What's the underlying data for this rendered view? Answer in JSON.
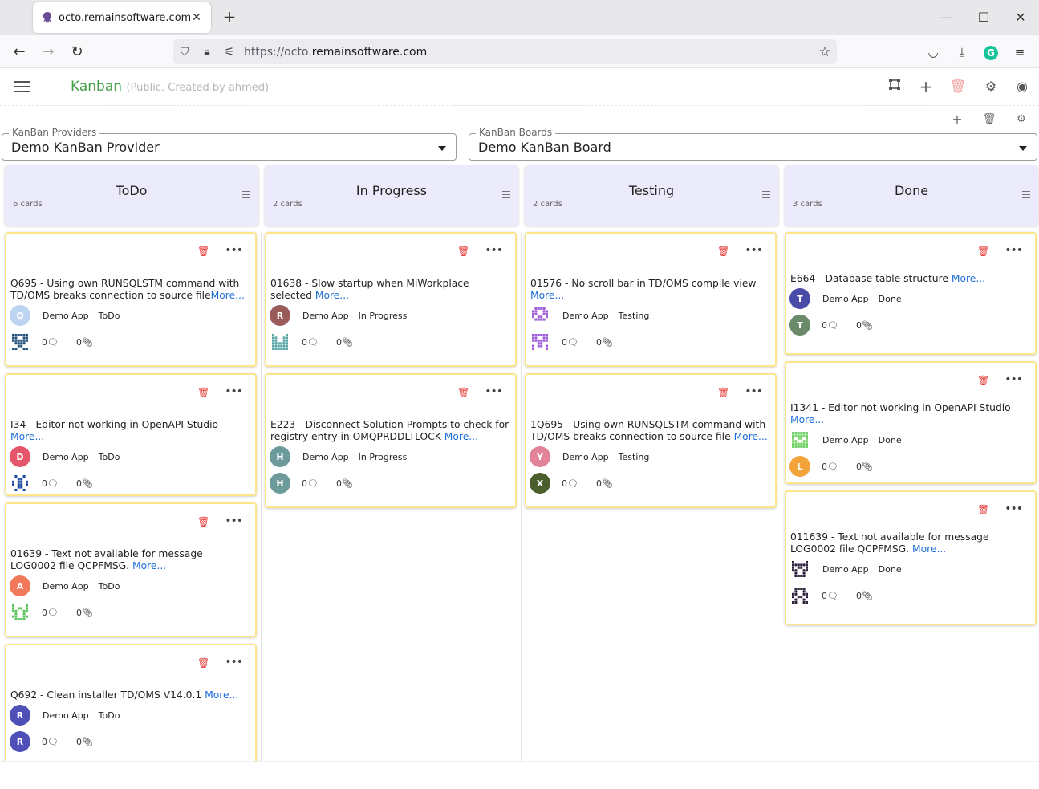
{
  "browser": {
    "tab_title": "octo.remainsoftware.com/",
    "url_scheme": "https://octo.",
    "url_host": "remainsoftware.com",
    "new_tab": "+",
    "close_tab": "✕"
  },
  "app": {
    "title": "Kanban",
    "subtitle": "(Public. Created by ahmed)"
  },
  "selects": {
    "providers_label": "KanBan Providers",
    "providers_value": "Demo KanBan Provider",
    "boards_label": "KanBan Boards",
    "boards_value": "Demo KanBan Board"
  },
  "columns": [
    {
      "name": "ToDo",
      "count": "6 cards",
      "cards": [
        {
          "id_title": " Q695 - Using own RUNSQLSTM command with TD/OMS breaks connection to source file",
          "more": "More...",
          "avatar": "Q",
          "avatar_color": "#bcd3f2",
          "app": "Demo App",
          "status": "ToDo",
          "comments": "0",
          "attachments": "0"
        },
        {
          "id_title": "I34 - Editor not working in OpenAPI Studio ",
          "more": "More...",
          "avatar": "D",
          "avatar_color": "#e5566a",
          "app": "Demo App",
          "status": "ToDo",
          "comments": "0",
          "attachments": "0"
        },
        {
          "id_title": "01639 - Text not available for message LOG0002 file QCPFMSG. ",
          "more": "More...",
          "avatar": "A",
          "avatar_color": "#f07a5b",
          "app": "Demo App",
          "status": "ToDo",
          "comments": "0",
          "attachments": "0"
        },
        {
          "id_title": "Q692 - Clean installer TD/OMS V14.0.1 ",
          "more": "More...",
          "avatar": "R",
          "avatar_color": "#4f4fb8",
          "app": "Demo App",
          "status": "ToDo",
          "comments": "0",
          "attachments": "0"
        }
      ]
    },
    {
      "name": "In Progress",
      "count": "2 cards",
      "cards": [
        {
          "id_title": "01638 - Slow startup when MiWorkplace selected ",
          "more": "More...",
          "avatar": "R",
          "avatar_color": "#9c5b5b",
          "app": "Demo App",
          "status": "In Progress",
          "comments": "0",
          "attachments": "0"
        },
        {
          "id_title": "E223 - Disconnect Solution Prompts to check for registry entry in OMQPRDDLTLOCK ",
          "more": "More...",
          "avatar": "H",
          "avatar_color": "#6d9a9a",
          "app": "Demo App",
          "status": "In Progress",
          "comments": "0",
          "attachments": "0"
        }
      ]
    },
    {
      "name": "Testing",
      "count": "2 cards",
      "cards": [
        {
          "id_title": "01576 - No scroll bar in TD/OMS compile view ",
          "more": "More...",
          "avatar": "",
          "avatar_color": "#ffffff",
          "app": "Demo App",
          "status": "Testing",
          "comments": "0",
          "attachments": "0"
        },
        {
          "id_title": " 1Q695 - Using own RUNSQLSTM command with TD/OMS breaks connection to source file ",
          "more": "More...",
          "avatar": "Y",
          "avatar_color": "#e2839a",
          "app": "Demo App",
          "status": "Testing",
          "comments": "0",
          "attachments": "0"
        }
      ]
    },
    {
      "name": "Done",
      "count": "3 cards",
      "cards": [
        {
          "id_title": "E664 - Database table structure ",
          "more": "More...",
          "avatar": "T",
          "avatar_color": "#4a4aa8",
          "app": "Demo App",
          "status": "Done",
          "comments": "0",
          "attachments": "0"
        },
        {
          "id_title": "I1341 - Editor not working in OpenAPI Studio ",
          "more": "More...",
          "avatar": "",
          "avatar_color": "#ffffff",
          "app": "Demo App",
          "status": "Done",
          "comments": "0",
          "attachments": "0"
        },
        {
          "id_title": "011639 - Text not available for message LOG0002 file QCPFMSG. ",
          "more": "More...",
          "avatar": "",
          "avatar_color": "#ffffff",
          "app": "Demo App",
          "status": "Done",
          "comments": "0",
          "attachments": "0"
        }
      ]
    }
  ],
  "second_avatars": {
    "todo_1": {
      "letter": "",
      "color": "#ffffff"
    },
    "todo_2": {
      "letter": "",
      "color": "#ffffff"
    },
    "todo_3": {
      "letter": "",
      "color": "#ffffff"
    },
    "todo_4": {
      "letter": "R",
      "color": "#4f4fb8"
    },
    "inprog_1": {
      "letter": "",
      "color": "#ffffff"
    },
    "inprog_2": {
      "letter": "H",
      "color": "#6d9a9a"
    },
    "testing_1": {
      "letter": "",
      "color": "#ffffff"
    },
    "testing_2": {
      "letter": "X",
      "color": "#4b5f2d"
    },
    "done_1": {
      "letter": "T",
      "color": "#6a8a6a"
    },
    "done_2": {
      "letter": "L",
      "color": "#f2a43a"
    },
    "done_3": {
      "letter": "",
      "color": "#ffffff"
    }
  }
}
